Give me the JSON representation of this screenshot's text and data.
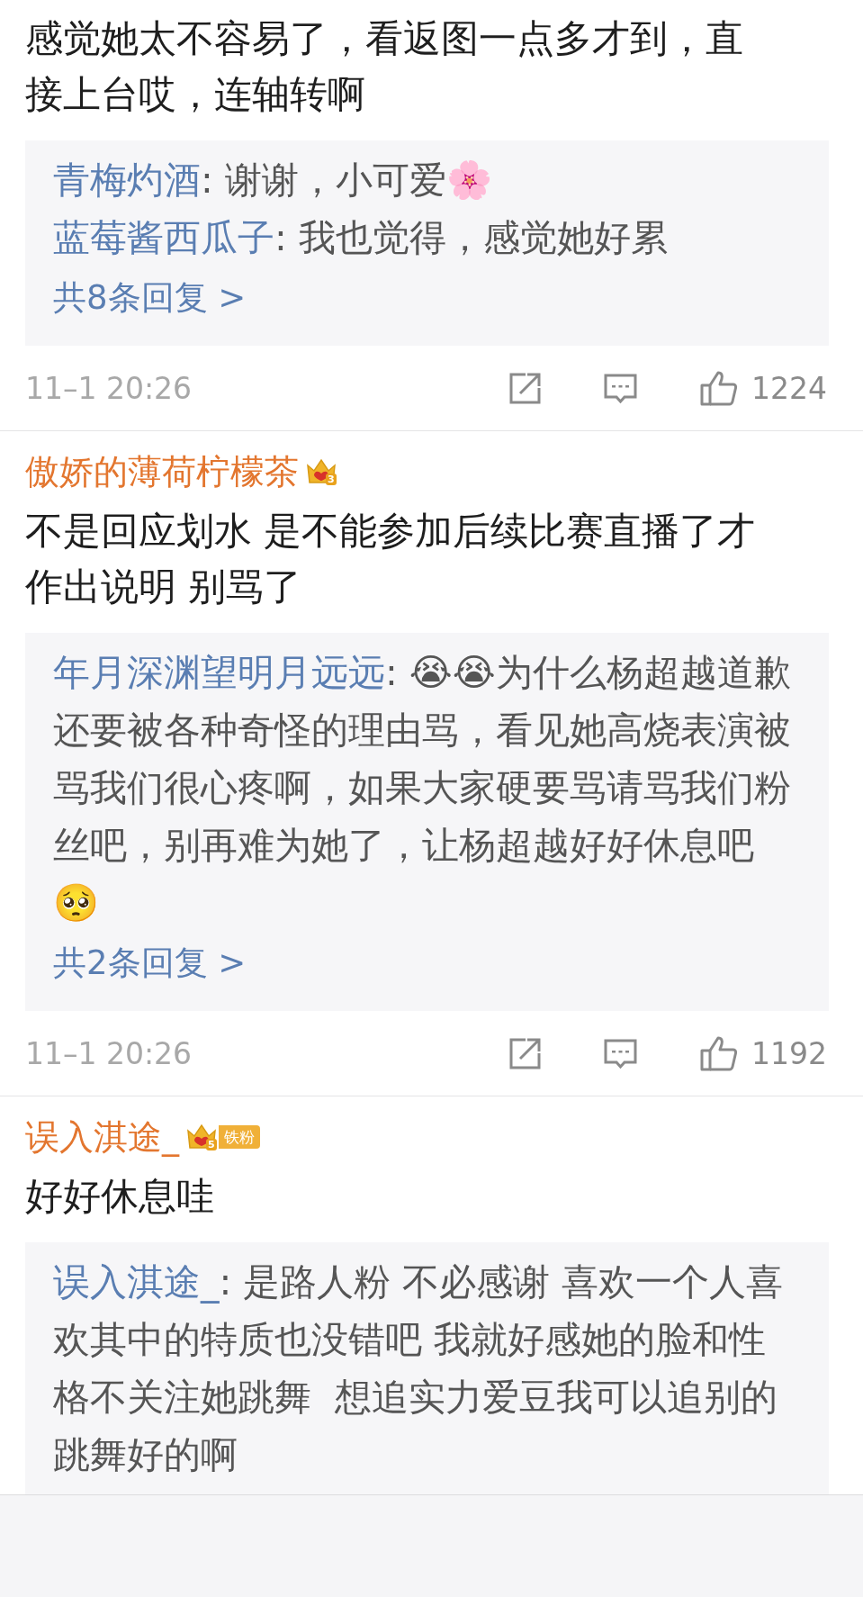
{
  "comments": [
    {
      "text": "感觉她太不容易了，看返图一点多才到，直接上台哎，连轴转啊",
      "replies": [
        {
          "author": "青梅灼酒",
          "text": ": 谢谢，小可爱🌸"
        },
        {
          "author": "蓝莓酱西瓜子",
          "text": ": 我也觉得，感觉她好累"
        }
      ],
      "more": "共8条回复 >",
      "time": "11–1 20:26",
      "likes": "1224"
    },
    {
      "author": "傲娇的薄荷柠檬茶",
      "badge": {
        "level": "3"
      },
      "text": "不是回应划水 是不能参加后续比赛直播了才作出说明 别骂了",
      "replies": [
        {
          "author": "年月深渊望明月远远",
          "text": ": 😭😭为什么杨超越道歉还要被各种奇怪的理由骂，看见她高烧表演被骂我们很心疼啊，如果大家硬要骂请骂我们粉丝吧，别再难为她了，让杨超越好好休息吧🥺"
        }
      ],
      "more": "共2条回复 >",
      "time": "11–1 20:26",
      "likes": "1192"
    },
    {
      "author": "误入淇途_",
      "badge": {
        "level": "5",
        "tag": "铁粉"
      },
      "text": "好好休息哇",
      "replies": [
        {
          "author": "误入淇途_",
          "text": ": 是路人粉 不必感谢 喜欢一个人喜欢其中的特质也没错吧 我就好感她的脸和性格不关注她跳舞  想追实力爱豆我可以追别的跳舞好的啊"
        }
      ]
    }
  ]
}
